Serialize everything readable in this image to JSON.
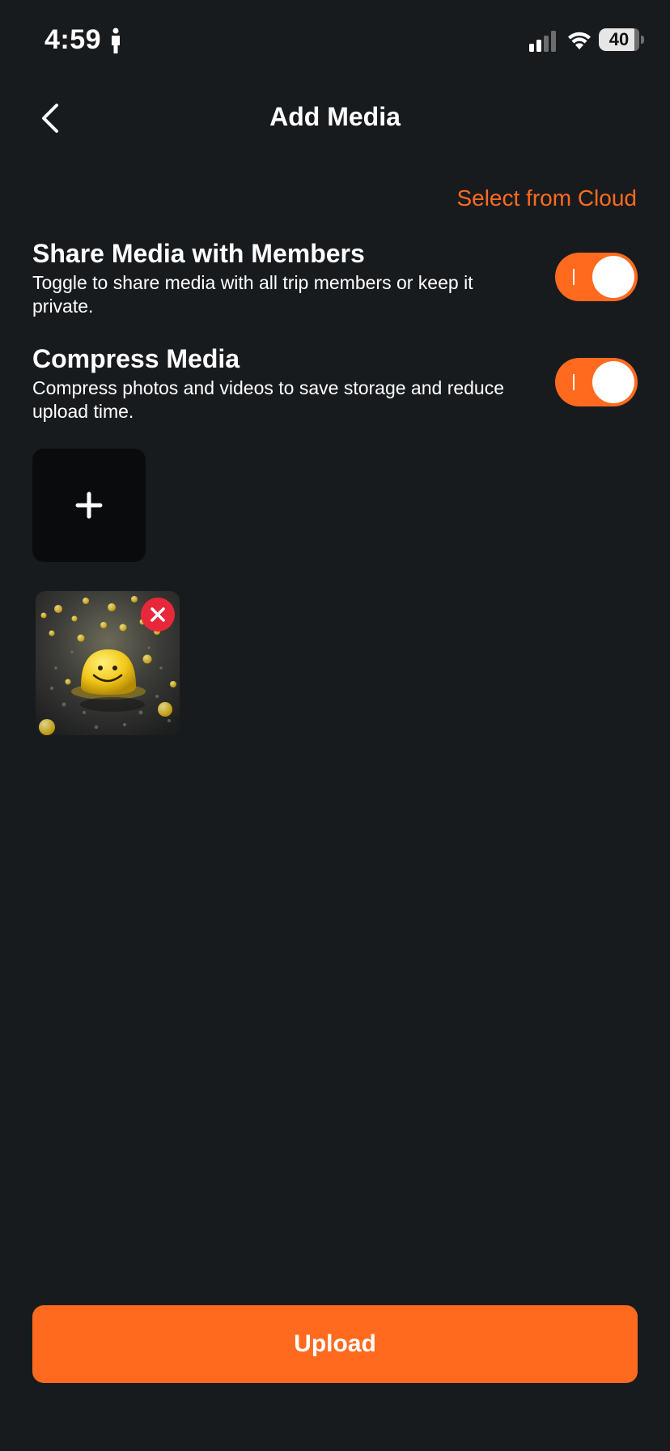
{
  "status_bar": {
    "time": "4:59",
    "battery": "40",
    "icons": [
      "person-icon",
      "signal-icon",
      "wifi-icon",
      "battery-icon"
    ]
  },
  "header": {
    "title": "Add Media",
    "back_icon": "chevron-left-icon"
  },
  "cloud_link": "Select from Cloud",
  "settings": [
    {
      "title": "Share Media with Members",
      "description": "Toggle to share media with all trip members or keep it private.",
      "enabled": true
    },
    {
      "title": "Compress Media",
      "description": "Compress photos and videos to save storage and reduce upload time.",
      "enabled": true
    }
  ],
  "media": {
    "add_icon": "plus-icon",
    "items": [
      {
        "thumbnail": "smiley-ball-photo",
        "remove_icon": "close-icon"
      }
    ]
  },
  "upload_label": "Upload",
  "colors": {
    "background": "#181b1e",
    "accent": "#ff6a1f",
    "tile": "#0a0b0c",
    "remove": "#e8283a",
    "text": "#ffffff"
  }
}
